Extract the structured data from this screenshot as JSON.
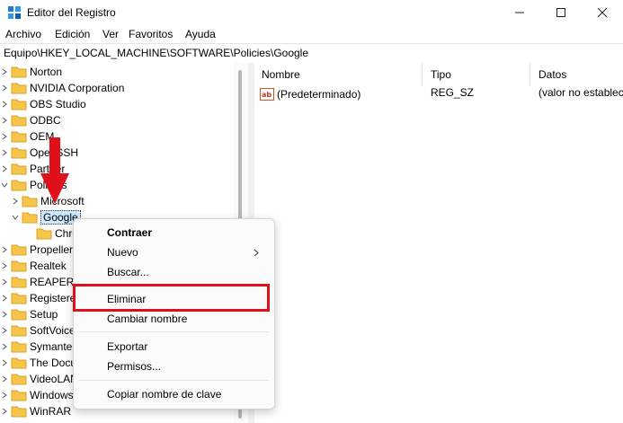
{
  "window": {
    "title": "Editor del Registro"
  },
  "menu": [
    "Archivo",
    "Edición",
    "Ver",
    "Favoritos",
    "Ayuda"
  ],
  "address": "Equipo\\HKEY_LOCAL_MACHINE\\SOFTWARE\\Policies\\Google",
  "tree": {
    "items": [
      "Norton",
      "NVIDIA Corporation",
      "OBS Studio",
      "ODBC",
      "OEM",
      "OpenSSH",
      "Partner",
      "Policies",
      "Microsoft",
      "Google",
      "Chrome",
      "Propellerhead",
      "Realtek",
      "REAPER",
      "RegisteredApplications",
      "Setup",
      "SoftVoice",
      "Symantec",
      "The Document Foundation",
      "VideoLAN",
      "Windows",
      "WinRAR"
    ]
  },
  "list": {
    "columns": [
      "Nombre",
      "Tipo",
      "Datos"
    ],
    "rows": [
      {
        "name": "(Predeterminado)",
        "type": "REG_SZ",
        "data": "(valor no establecido)"
      }
    ]
  },
  "context_menu": {
    "items": [
      "Contraer",
      "Nuevo",
      "Buscar...",
      "Eliminar",
      "Cambiar nombre",
      "Exportar",
      "Permisos...",
      "Copiar nombre de clave"
    ]
  },
  "colors": {
    "folder": "#f6c54a",
    "folder_edge": "#d9a22a",
    "annotation": "#e0101b",
    "selection": "#cce8ff"
  }
}
